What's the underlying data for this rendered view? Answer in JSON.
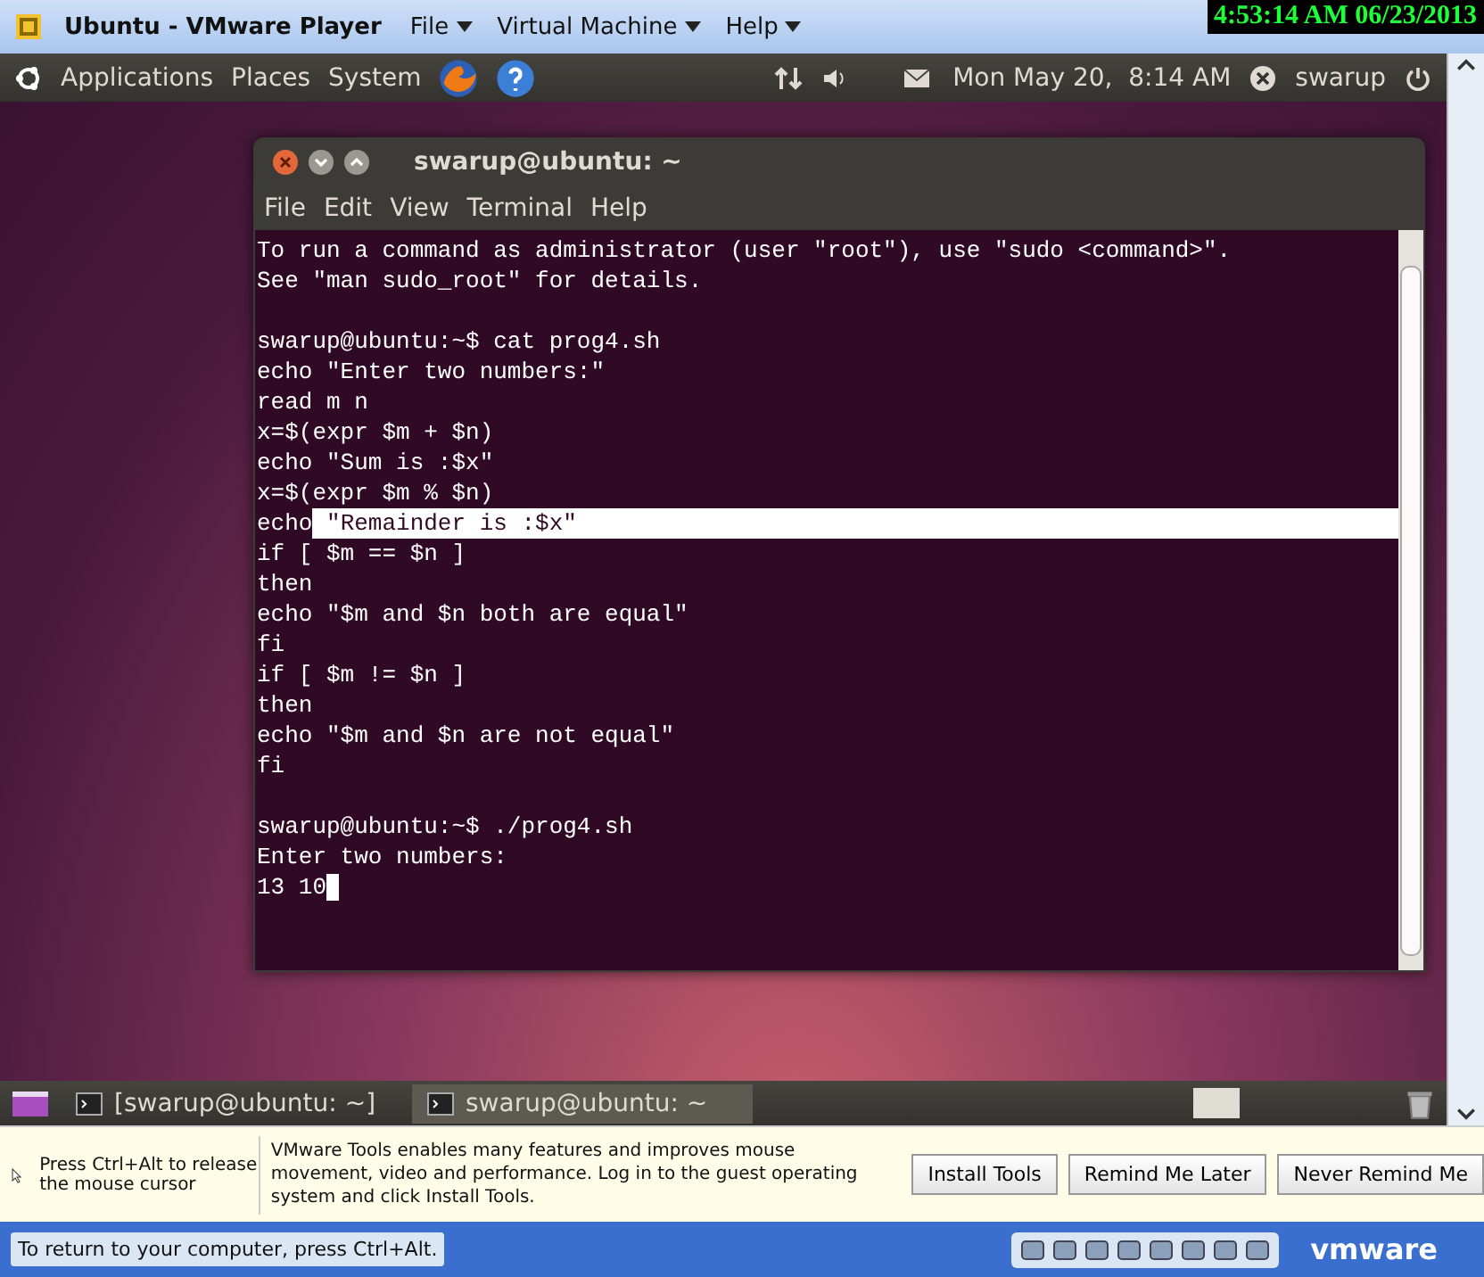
{
  "window": {
    "title": "Ubuntu - VMware Player",
    "menus": [
      {
        "label": "File"
      },
      {
        "label": "Virtual Machine"
      },
      {
        "label": "Help"
      }
    ]
  },
  "recording_timestamp": "4:53:14 AM 06/23/2013",
  "top_panel": {
    "menus": [
      "Applications",
      "Places",
      "System"
    ],
    "clock": "Mon May 20,  8:14 AM",
    "user": "swarup"
  },
  "terminal": {
    "title": "swarup@ubuntu: ~",
    "menus": [
      "File",
      "Edit",
      "View",
      "Terminal",
      "Help"
    ],
    "cursor": true,
    "blocks": [
      [
        {
          "text": "To run a command as administrator (user \"root\"), use \"sudo <command>\"."
        },
        {
          "text": "See \"man sudo_root\" for details."
        }
      ],
      [
        {
          "text": "swarup@ubuntu:~$ cat prog4.sh"
        },
        {
          "text": "echo \"Enter two numbers:\""
        },
        {
          "text": "read m n"
        },
        {
          "text": "x=$(expr $m + $n)"
        },
        {
          "text": "echo \"Sum is :$x\""
        },
        {
          "text": "x=$(expr $m % $n)"
        },
        {
          "text": "echo",
          "selected_text": " \"Remainder is :$x\""
        },
        {
          "text": "if [ $m == $n ]"
        },
        {
          "text": "then"
        },
        {
          "text": "echo \"$m and $n both are equal\""
        },
        {
          "text": "fi"
        },
        {
          "text": "if [ $m != $n ]"
        },
        {
          "text": "then"
        },
        {
          "text": "echo \"$m and $n are not equal\""
        },
        {
          "text": "fi"
        }
      ],
      [
        {
          "text": "swarup@ubuntu:~$ ./prog4.sh"
        },
        {
          "text": "Enter two numbers:"
        },
        {
          "text": "13 10"
        }
      ]
    ]
  },
  "bottom_panel": {
    "tasks": [
      {
        "label": "[swarup@ubuntu: ~]",
        "selected": false
      },
      {
        "label": "swarup@ubuntu: ~",
        "selected": true
      }
    ]
  },
  "tools_bar": {
    "hint": "Press Ctrl+Alt to release the mouse cursor",
    "message": "VMware Tools enables many features and improves mouse movement, video and performance. Log in to the guest operating system and click Install Tools.",
    "buttons": [
      "Install Tools",
      "Remind Me Later",
      "Never Remind Me"
    ]
  },
  "status_bar": {
    "text": "To return to your computer, press Ctrl+Alt.",
    "logo": "vmware"
  }
}
